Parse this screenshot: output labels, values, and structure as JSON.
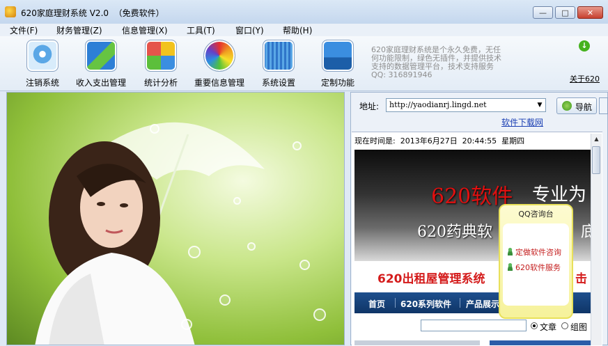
{
  "window": {
    "title": "620家庭理财系统 V2.0  （免费软件）",
    "buttons": {
      "minimize": "—",
      "maximize": "□",
      "close": "✕"
    }
  },
  "menu": [
    {
      "label": "文件(F)"
    },
    {
      "label": "财务管理(Z)"
    },
    {
      "label": "信息管理(X)"
    },
    {
      "label": "工具(T)"
    },
    {
      "label": "窗口(Y)"
    },
    {
      "label": "帮助(H)"
    }
  ],
  "toolbar": {
    "items": [
      {
        "label": "注销系统",
        "icon": "logout-icon"
      },
      {
        "label": "收入支出管理",
        "icon": "finance-icon"
      },
      {
        "label": "统计分析",
        "icon": "puzzle-icon"
      },
      {
        "label": "重要信息管理",
        "icon": "color-wheel-icon"
      },
      {
        "label": "系统设置",
        "icon": "waveform-icon"
      },
      {
        "label": "定制功能",
        "icon": "battery-icon"
      }
    ],
    "description": "620家庭理财系统是个永久免费，无任何功能限制，绿色无插件，并提供技术支持的数据管理平台，技术支持服务QQ: 316891946",
    "about_label": "关于620"
  },
  "browser": {
    "address_label": "地址:",
    "address_value": "http://yaodianrj.lingd.net",
    "nav_button_label": "导航",
    "download_link": "软件下载网",
    "time_text": "现在时间是:  2013年6月27日  20:44:55  星期四",
    "banner_line1a": "620软件",
    "banner_line1b": "专业为",
    "banner_line2": "620药典软",
    "banner_line2b": "底",
    "sub_banner": "620出租屋管理系统",
    "sub_banner_tail": "击",
    "site_nav": [
      "首页",
      "620系列软件",
      "产品展示"
    ],
    "search_options": [
      {
        "label": "文章",
        "checked": true
      },
      {
        "label": "组图",
        "checked": false
      }
    ]
  },
  "qq_popup": {
    "title": "QQ咨询台",
    "items": [
      "定做软件咨询",
      "620软件服务"
    ]
  }
}
